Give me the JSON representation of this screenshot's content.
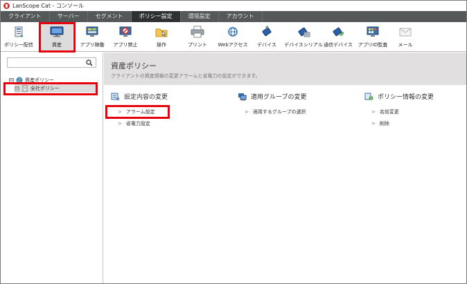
{
  "window": {
    "title": "LanScope Cat - コンソール"
  },
  "tabs": [
    {
      "label": "クライアント",
      "active": false
    },
    {
      "label": "サーバー",
      "active": false
    },
    {
      "label": "セグメント",
      "active": false
    },
    {
      "label": "ポリシー設定",
      "active": true
    },
    {
      "label": "環境設定",
      "active": false
    },
    {
      "label": "アカウント",
      "active": false
    }
  ],
  "toolbar": {
    "items": [
      {
        "label": "ポリシー配信",
        "icon": "policy-deploy-icon"
      },
      {
        "label": "資産",
        "icon": "asset-monitor-icon",
        "selected": true
      },
      {
        "label": "アプリ稼働",
        "icon": "app-running-icon"
      },
      {
        "label": "アプリ禁止",
        "icon": "app-prohibit-icon"
      },
      {
        "label": "操作",
        "icon": "operation-folder-icon"
      },
      {
        "label": "プリント",
        "icon": "printer-icon"
      },
      {
        "label": "Webアクセス",
        "icon": "globe-icon"
      },
      {
        "label": "デバイス",
        "icon": "device-icon"
      },
      {
        "label": "デバイスシリアル",
        "icon": "device-serial-icon"
      },
      {
        "label": "通信デバイス",
        "icon": "comm-device-icon"
      },
      {
        "label": "アプリID監査",
        "icon": "app-id-audit-icon"
      },
      {
        "label": "メール",
        "icon": "mail-icon"
      }
    ]
  },
  "left": {
    "search": {
      "placeholder": "",
      "value": ""
    },
    "tree": [
      {
        "label": "資産ポリシー",
        "expander": "⊟"
      },
      {
        "label": "全社ポリシー",
        "expander": "⊞",
        "selected": true
      }
    ]
  },
  "main": {
    "title": "資産ポリシー",
    "description": "クライアントの資産情報の変更アラームと省電力の設定ができます。",
    "sections": [
      {
        "title": "設定内容の変更",
        "icon": "settings-change-icon",
        "links": [
          "アラーム設定",
          "省電力設定"
        ]
      },
      {
        "title": "適用グループの変更",
        "icon": "group-change-icon",
        "links": [
          "適用するグループの選択"
        ]
      },
      {
        "title": "ポリシー情報の変更",
        "icon": "policy-info-icon",
        "links": [
          "名前変更",
          "削除"
        ]
      }
    ]
  },
  "colors": {
    "tabbar": "#555859",
    "tab_active": "#2e3132",
    "header_bg": "#e2dfe1",
    "highlight": "#e8000b"
  }
}
